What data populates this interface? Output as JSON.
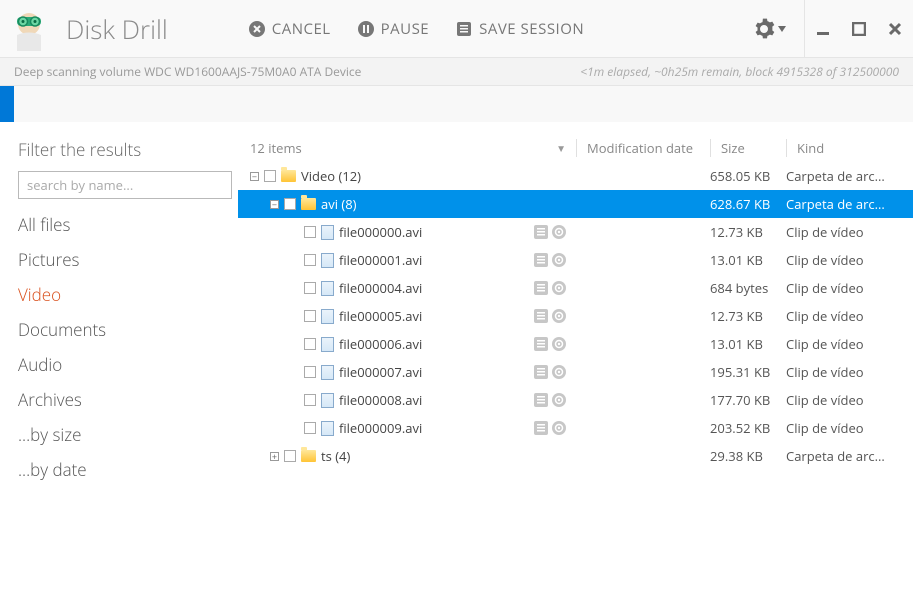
{
  "app": {
    "title": "Disk Drill"
  },
  "toolbar": {
    "cancel": "CANCEL",
    "pause": "PAUSE",
    "save_session": "SAVE SESSION"
  },
  "status": {
    "left": "Deep scanning volume WDC WD1600AAJS-75M0A0 ATA Device",
    "right": "<1m elapsed, ~0h25m remain, block 4915328 of 312500000"
  },
  "sidebar": {
    "title": "Filter the results",
    "search_placeholder": "search by name...",
    "categories": [
      {
        "label": "All files",
        "active": false
      },
      {
        "label": "Pictures",
        "active": false
      },
      {
        "label": "Video",
        "active": true
      },
      {
        "label": "Documents",
        "active": false
      },
      {
        "label": "Audio",
        "active": false
      },
      {
        "label": "Archives",
        "active": false
      },
      {
        "label": "...by size",
        "active": false
      },
      {
        "label": "...by date",
        "active": false
      }
    ]
  },
  "columns": {
    "items_count": "12 items",
    "mod": "Modification date",
    "size": "Size",
    "kind": "Kind"
  },
  "tree": [
    {
      "type": "folder",
      "indent": 0,
      "expander": "-",
      "name": "Video  (12)",
      "size": "658.05 KB",
      "kind": "Carpeta de arc...",
      "selected": false
    },
    {
      "type": "folder",
      "indent": 1,
      "expander": "-",
      "name": "avi (8)",
      "size": "628.67 KB",
      "kind": "Carpeta de arc...",
      "selected": true
    },
    {
      "type": "file",
      "indent": 2,
      "name": "file000000.avi",
      "size": "12.73 KB",
      "kind": "Clip de vídeo"
    },
    {
      "type": "file",
      "indent": 2,
      "name": "file000001.avi",
      "size": "13.01 KB",
      "kind": "Clip de vídeo"
    },
    {
      "type": "file",
      "indent": 2,
      "name": "file000004.avi",
      "size": "684 bytes",
      "kind": "Clip de vídeo"
    },
    {
      "type": "file",
      "indent": 2,
      "name": "file000005.avi",
      "size": "12.73 KB",
      "kind": "Clip de vídeo"
    },
    {
      "type": "file",
      "indent": 2,
      "name": "file000006.avi",
      "size": "13.01 KB",
      "kind": "Clip de vídeo"
    },
    {
      "type": "file",
      "indent": 2,
      "name": "file000007.avi",
      "size": "195.31 KB",
      "kind": "Clip de vídeo"
    },
    {
      "type": "file",
      "indent": 2,
      "name": "file000008.avi",
      "size": "177.70 KB",
      "kind": "Clip de vídeo"
    },
    {
      "type": "file",
      "indent": 2,
      "name": "file000009.avi",
      "size": "203.52 KB",
      "kind": "Clip de vídeo"
    },
    {
      "type": "folder",
      "indent": 1,
      "expander": "+",
      "name": "ts  (4)",
      "size": "29.38 KB",
      "kind": "Carpeta de arc...",
      "selected": false
    }
  ]
}
